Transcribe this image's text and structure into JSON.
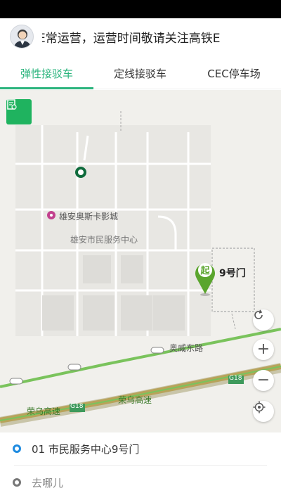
{
  "header": {
    "notice_text": "E常运营，运营时间敬请关注高铁E",
    "avatar_icon": "user-avatar-icon"
  },
  "tabs": [
    {
      "label": "弹性接驳车",
      "active": true
    },
    {
      "label": "定线接驳车",
      "active": false
    },
    {
      "label": "CEC停车场",
      "active": false
    }
  ],
  "map": {
    "poi_cinema": "雄安奥斯卡影城",
    "poi_service_center": "雄安市民服务中心",
    "road_aowei": "奥威东路",
    "road_rongwu_1": "荣乌高速",
    "road_rongwu_2": "荣乌高速",
    "highway_shield_1": "G18",
    "highway_shield_2": "G18",
    "pin_start_char": "起",
    "pin_label": "9号门",
    "colors": {
      "accent": "#2bb47d",
      "pin": "#5aa52d",
      "road": "#7ac35c",
      "highway": "#b8a35a"
    },
    "controls": {
      "refresh_icon": "refresh-icon",
      "zoom_in_glyph": "+",
      "zoom_out_glyph": "−",
      "locate_icon": "locate-icon",
      "layer_icon": "layer-icon"
    }
  },
  "trip": {
    "origin": "01 市民服务中心9号门",
    "destination_placeholder": "去哪儿"
  }
}
